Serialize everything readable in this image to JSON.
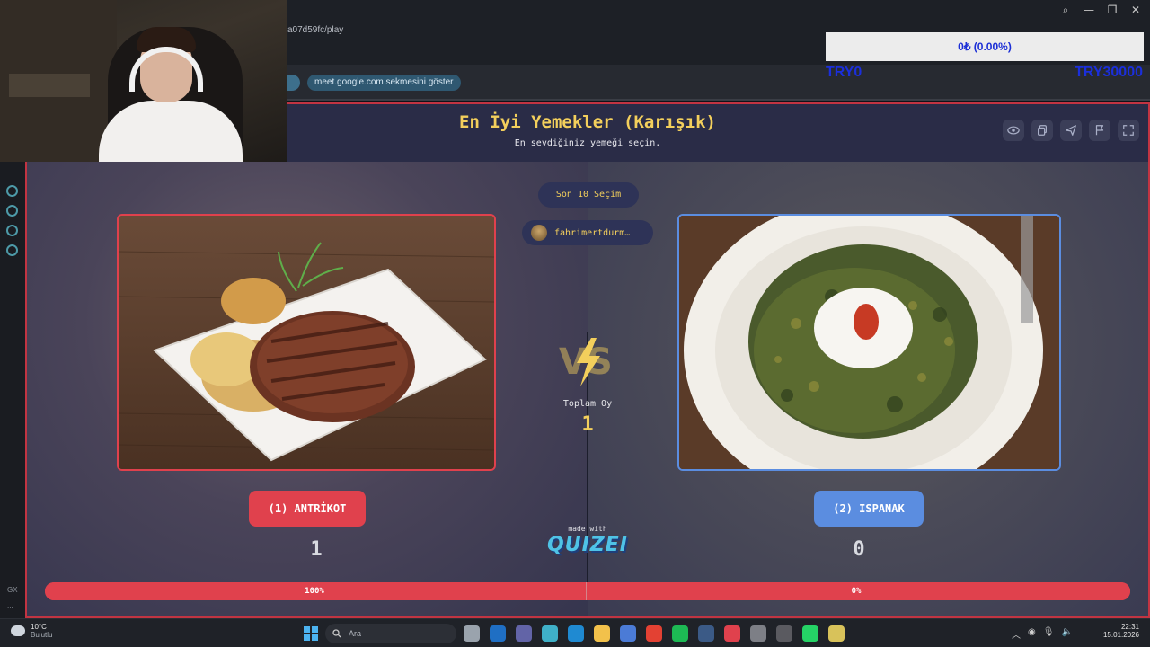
{
  "browser": {
    "url_fragment": "a07d59fc/play",
    "infobar_pill": "meet.google.com sekmesini göster"
  },
  "donation": {
    "status": "0₺ (0.00%)",
    "min_label": "TRY0",
    "max_label": "TRY30000"
  },
  "quiz": {
    "title": "En İyi Yemekler (Karışık)",
    "subtitle": "En sevdiğiniz yemeği seçin.",
    "toolbar_icons": [
      "eye-icon",
      "copy-icon",
      "send-icon",
      "flag-icon",
      "fullscreen-icon"
    ],
    "recent_button": "Son 10 Seçim",
    "recent_voter": "fahrimertdurm…",
    "vs_label": "VS",
    "total_label": "Toplam Oy",
    "total_value": "1",
    "options": [
      {
        "label": "(1) ANTRİKOT",
        "votes": "1",
        "percent_label": "100%",
        "share": 1.0,
        "color": "#e0414d"
      },
      {
        "label": "(2) ISPANAK",
        "votes": "0",
        "percent_label": "0%",
        "share": 0.0,
        "color": "#5b8de0"
      }
    ],
    "made_with": "made with",
    "brand": "QUIZEI"
  },
  "sidebar": {
    "bottom_label": "GX",
    "more_label": "..."
  },
  "taskbar": {
    "weather_temp": "10°C",
    "weather_desc": "Bulutlu",
    "search_placeholder": "Ara",
    "time": "22:31",
    "date": "15.01.2026",
    "apps": [
      {
        "name": "task-view-icon",
        "color": "#9aa3ad"
      },
      {
        "name": "outlook-icon",
        "color": "#1f6fc4"
      },
      {
        "name": "teams-icon",
        "color": "#6264a7"
      },
      {
        "name": "copilot-icon",
        "color": "#3fb0c7"
      },
      {
        "name": "edge-icon",
        "color": "#1f8ad2"
      },
      {
        "name": "file-explorer-icon",
        "color": "#f2c14b"
      },
      {
        "name": "store-icon",
        "color": "#4b7bd6"
      },
      {
        "name": "chrome-icon",
        "color": "#e34133"
      },
      {
        "name": "spotify-icon",
        "color": "#1db954"
      },
      {
        "name": "steam-icon",
        "color": "#3b5a86"
      },
      {
        "name": "opera-gx-icon",
        "color": "#e0414d"
      },
      {
        "name": "app-icon",
        "color": "#7d7f86"
      },
      {
        "name": "obs-icon",
        "color": "#5a5a60"
      },
      {
        "name": "whatsapp-icon",
        "color": "#25d366"
      },
      {
        "name": "notepad-icon",
        "color": "#d8c25a"
      }
    ]
  }
}
